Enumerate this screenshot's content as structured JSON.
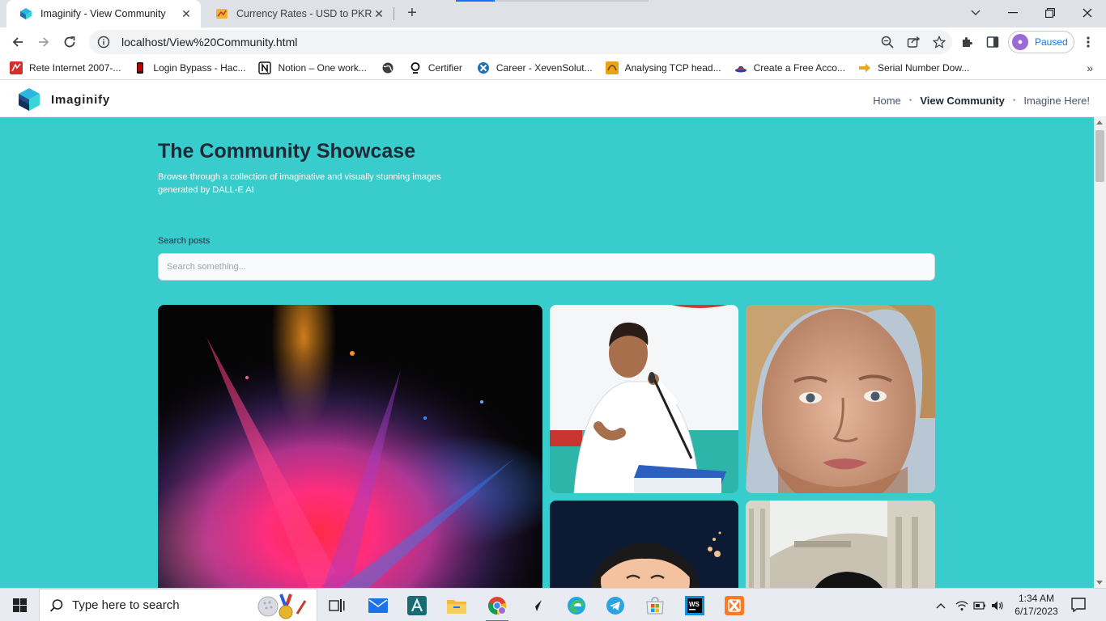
{
  "browser": {
    "tabs": [
      {
        "title": "Imaginify - View Community",
        "active": true
      },
      {
        "title": "Currency Rates - USD to PKR - FO",
        "active": false
      }
    ],
    "url": "localhost/View%20Community.html",
    "profile_label": "Paused",
    "bookmarks": [
      {
        "label": "Rete Internet 2007-...",
        "icon": "red-bookmark-icon"
      },
      {
        "label": "Login Bypass - Hac...",
        "icon": "phone-icon"
      },
      {
        "label": "Notion – One work...",
        "icon": "notion-icon"
      },
      {
        "label": "",
        "icon": "globe-icon"
      },
      {
        "label": "Certifier",
        "icon": "certifier-icon"
      },
      {
        "label": "Career - XevenSolut...",
        "icon": "xeven-icon"
      },
      {
        "label": "Analysing TCP head...",
        "icon": "wireshark-icon"
      },
      {
        "label": "Create a Free Acco...",
        "icon": "hat-icon"
      },
      {
        "label": "Serial Number Dow...",
        "icon": "arrow-icon"
      }
    ]
  },
  "site": {
    "brand": "Imaginify",
    "nav": {
      "home": "Home",
      "view_community": "View Community",
      "imagine": "Imagine Here!"
    },
    "title": "The Community Showcase",
    "subtitle": "Browse through a collection of imaginative and visually stunning images generated by DALL-E AI",
    "search": {
      "label": "Search posts",
      "placeholder": "Search something..."
    },
    "colors": {
      "background": "#39cccc",
      "header": "#ffffff"
    }
  },
  "taskbar": {
    "search_placeholder": "Type here to search",
    "time": "1:34 AM",
    "date": "6/17/2023"
  }
}
